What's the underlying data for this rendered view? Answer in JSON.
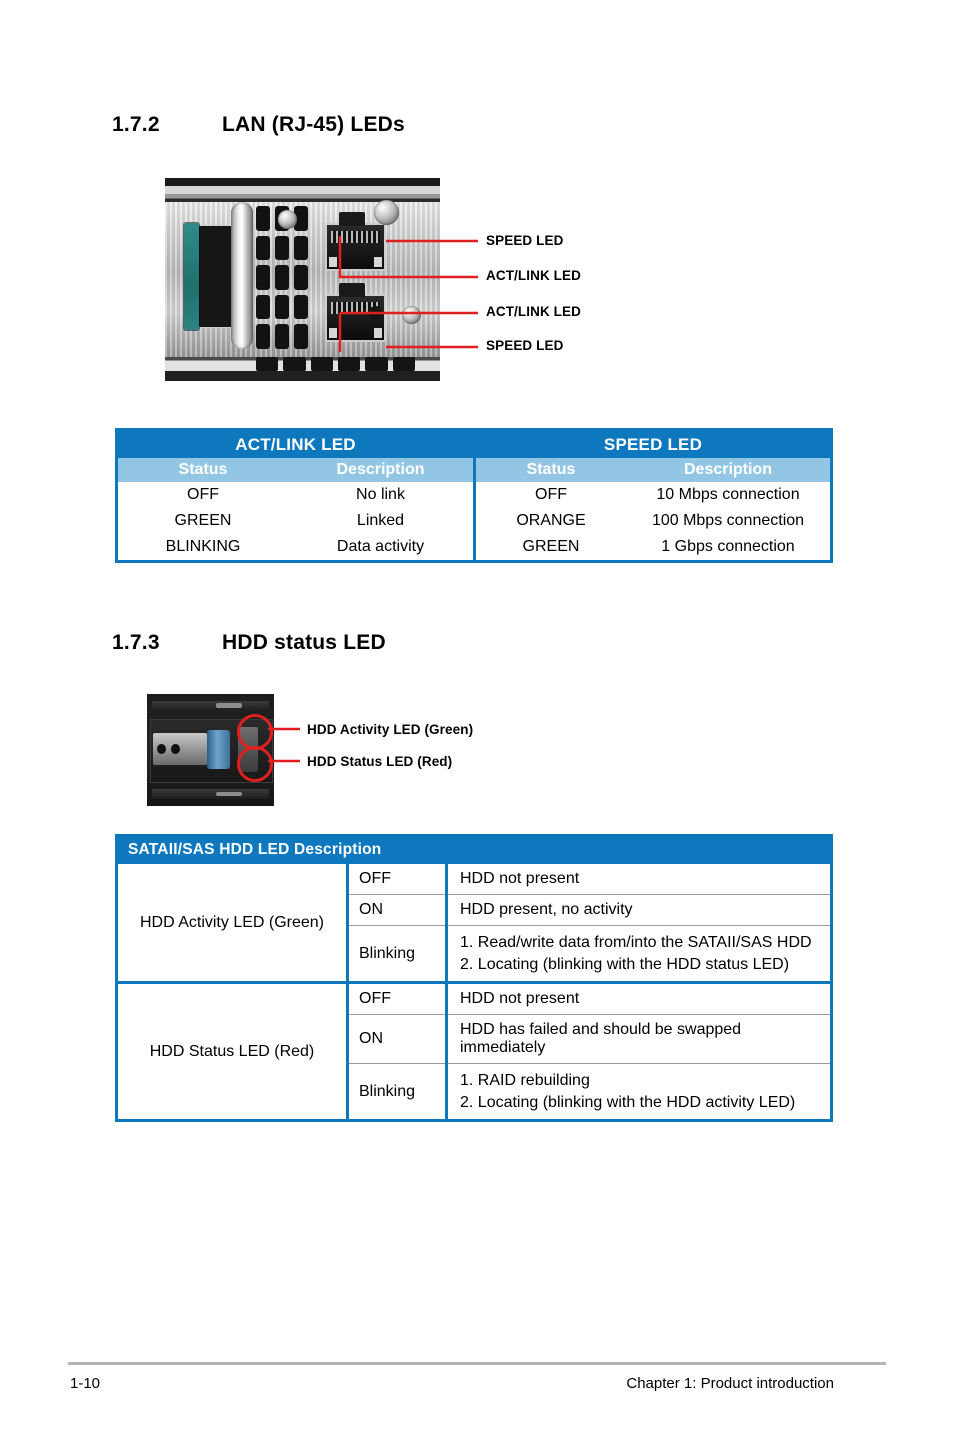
{
  "sections": {
    "lan": {
      "number": "1.7.2",
      "title": "LAN (RJ-45) LEDs"
    },
    "hdd": {
      "number": "1.7.3",
      "title": "HDD status LED"
    }
  },
  "lan_figure": {
    "callouts": [
      {
        "label": "SPEED LED"
      },
      {
        "label": "ACT/LINK LED"
      },
      {
        "label": "ACT/LINK LED"
      },
      {
        "label": "SPEED LED"
      }
    ]
  },
  "lan_table": {
    "group_headers": [
      "ACT/LINK LED",
      "SPEED LED"
    ],
    "column_headers": [
      "Status",
      "Description",
      "Status",
      "Description"
    ],
    "rows": [
      [
        "OFF",
        "No link",
        "OFF",
        "10 Mbps connection"
      ],
      [
        "GREEN",
        "Linked",
        "ORANGE",
        "100 Mbps connection"
      ],
      [
        "BLINKING",
        "Data activity",
        "GREEN",
        "1 Gbps connection"
      ]
    ]
  },
  "hdd_figure": {
    "callouts": [
      {
        "label": "HDD Activity LED (Green)"
      },
      {
        "label": "HDD Status LED (Red)"
      }
    ]
  },
  "hdd_table": {
    "title": "SATAII/SAS HDD LED Description",
    "groups": [
      {
        "name": "HDD Activity LED (Green)",
        "rows": [
          {
            "state": "OFF",
            "description": "HDD not present"
          },
          {
            "state": "ON",
            "description": "HDD present, no activity"
          },
          {
            "state": "Blinking",
            "description_line1": "1. Read/write data from/into the SATAII/SAS HDD",
            "description_line2": "2. Locating (blinking with the HDD status LED)"
          }
        ]
      },
      {
        "name": "HDD Status LED (Red)",
        "rows": [
          {
            "state": "OFF",
            "description": "HDD not present"
          },
          {
            "state": "ON",
            "description": "HDD has failed and should be swapped immediately"
          },
          {
            "state": "Blinking",
            "description_line1": "1. RAID rebuilding",
            "description_line2": "2. Locating (blinking with the HDD activity LED)"
          }
        ]
      }
    ]
  },
  "footer": {
    "page_number": "1-10",
    "chapter": "Chapter 1:  Product introduction"
  },
  "colors": {
    "table_header_blue": "#0E78BE",
    "table_subheader_blue": "#93C6E4",
    "callout_red": "#E02020",
    "connector_teal": "#2f8d89"
  }
}
